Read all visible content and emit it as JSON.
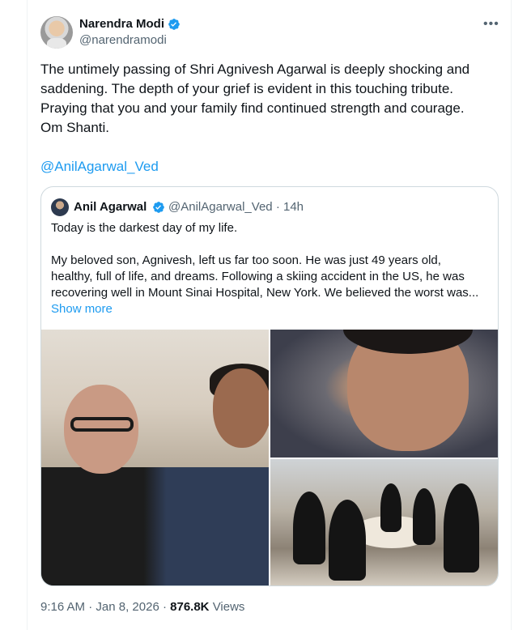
{
  "tweet": {
    "author": {
      "name": "Narendra Modi",
      "handle": "@narendramodi",
      "verified": true
    },
    "more_icon": "more-horizontal-icon",
    "text": "The untimely passing of Shri Agnivesh Agarwal is deeply shocking and\nsaddening. The depth of your grief is evident in this touching tribute.\nPraying that you and your family find continued strength and courage.\nOm Shanti.",
    "mention": "@AnilAgarwal_Ved",
    "quoted": {
      "name": "Anil Agarwal",
      "handle": "@AnilAgarwal_Ved",
      "separator": "·",
      "time": "14h",
      "verified": true,
      "text": "Today is the darkest day of my life.\n\nMy beloved son, Agnivesh, left us far too soon. He was just 49 years old,\nhealthy, full of life, and dreams. Following a skiing accident in the US, he was\nrecovering well in Mount Sinai Hospital, New York. We believed the worst was...",
      "show_more": "Show more",
      "photos": [
        "photo-1",
        "photo-2",
        "photo-3"
      ]
    },
    "footer": {
      "time": "9:16 AM",
      "date": "Jan 8, 2026",
      "views_count": "876.8K",
      "views_label": "Views"
    },
    "colors": {
      "accent": "#1d9bf0",
      "text": "#0f1419",
      "muted": "#536471",
      "border": "#cfd9de"
    }
  }
}
